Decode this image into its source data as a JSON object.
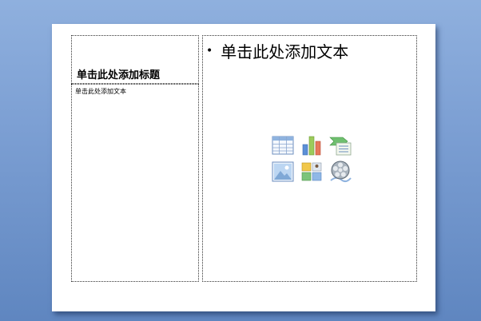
{
  "slide": {
    "title_placeholder": "单击此处添加标题",
    "text_placeholder": "单击此处添加文本",
    "content_placeholder": "单击此处添加文本"
  },
  "content_icons": [
    {
      "name": "table-icon"
    },
    {
      "name": "chart-icon"
    },
    {
      "name": "smartart-icon"
    },
    {
      "name": "picture-icon"
    },
    {
      "name": "clip-art-icon"
    },
    {
      "name": "media-clip-icon"
    }
  ],
  "colors": {
    "background_top": "#8fb0de",
    "background_bottom": "#5f86c0",
    "slide": "#ffffff",
    "placeholder_border": "#333333"
  }
}
